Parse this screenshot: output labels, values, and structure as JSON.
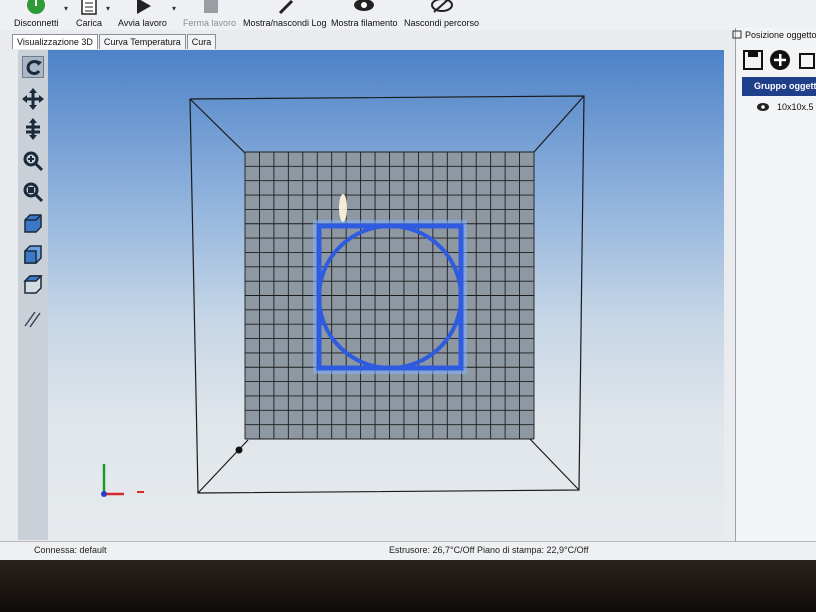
{
  "toolbar": {
    "disconnect": "Disconnetti",
    "load": "Carica",
    "start": "Avvia lavoro",
    "stop": "Ferma lavoro",
    "toggle_log": "Mostra/nascondi Log",
    "show_filament": "Mostra filamento",
    "hide_path": "Nascondi percorso"
  },
  "tabs": [
    "Visualizzazione 3D",
    "Curva Temperatura",
    "Cura"
  ],
  "right_panel": {
    "title": "Posizione oggetto",
    "group_label": "Gruppo oggetti",
    "object_name": "10x10x.5"
  },
  "status": {
    "connection": "Connessa: default",
    "temperatures": "Estrusore: 26,7°C/Off Piano di stampa: 22,9°C/Off"
  },
  "colors": {
    "object_outline": "#2f5be0",
    "sky_top": "#4e82c8",
    "group_bg": "#1f3f8a"
  }
}
